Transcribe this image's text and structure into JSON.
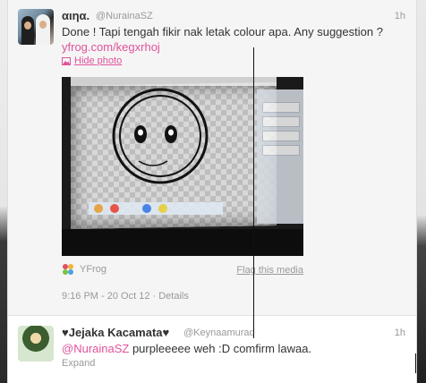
{
  "tweet1": {
    "name": "αιηα.",
    "handle": "@NurainaSZ",
    "time": "1h",
    "text": "Done ! Tapi tengah fikir nak letak colour apa. Any suggestion ?",
    "link": "yfrog.com/kegxrhoj",
    "hide_photo": "Hide photo",
    "media_source": "YFrog",
    "flag": "Flag this media",
    "timestamp": "9:16 PM - 20 Oct 12",
    "details": "Details"
  },
  "tweet2": {
    "name": "♥Jejaka Kacamata♥",
    "handle": "@Keynaamurad",
    "time": "1h",
    "mention": "@NurainaSZ",
    "text": " purpleeeee weh :D comfirm lawaa.",
    "expand": "Expand"
  },
  "colors": {
    "link": "#e0529a",
    "muted": "#999999",
    "text": "#333333"
  },
  "icons": {
    "hide_photo": "photo-icon",
    "media_source": "yfrog-logo-icon"
  }
}
